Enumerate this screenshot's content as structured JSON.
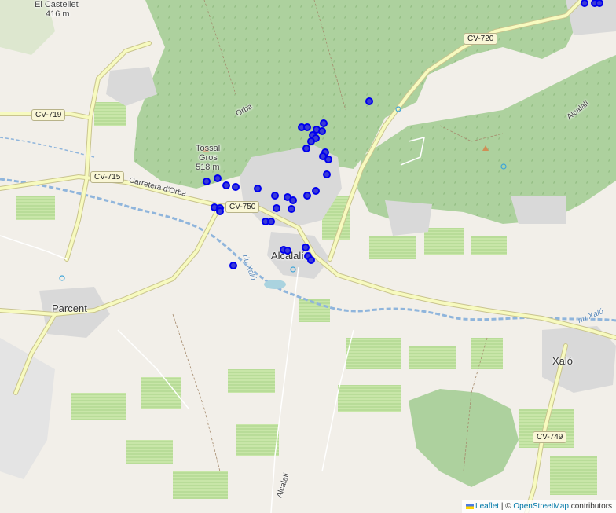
{
  "map": {
    "labels": {
      "el_castellet": "El Castellet",
      "el_castellet_elev": "416 m",
      "tossal_gros": "Tossal",
      "tossal_gros_2": "Gros",
      "tossal_gros_elev": "518 m",
      "orba": "Orba",
      "carretera_orba": "Carretera d'Orba",
      "alcalali_town": "Alcalalí",
      "alcalali_road": "Alcalalí",
      "alcalali_ridge": "Alcalalí",
      "parcent": "Parcent",
      "xalo": "Xaló",
      "riu_xalo_1": "riu Xaló",
      "riu_xalo_2": "riu Xaló"
    },
    "roads": {
      "cv719": "CV-719",
      "cv715": "CV-715",
      "cv750": "CV-750",
      "cv720": "CV-720",
      "cv749": "CV-749"
    },
    "colors": {
      "background": "#f2efe9",
      "forest": "#add19e",
      "farmland": "#c8e6a8",
      "residential": "#e0dfdf",
      "water": "#aad3df",
      "road": "#f7fabf",
      "marker": "#0000ee"
    },
    "marker_count": 44
  },
  "attribution": {
    "leaflet": "Leaflet",
    "separator": "| ©",
    "osm": "OpenStreetMap",
    "contributors": "contributors"
  }
}
